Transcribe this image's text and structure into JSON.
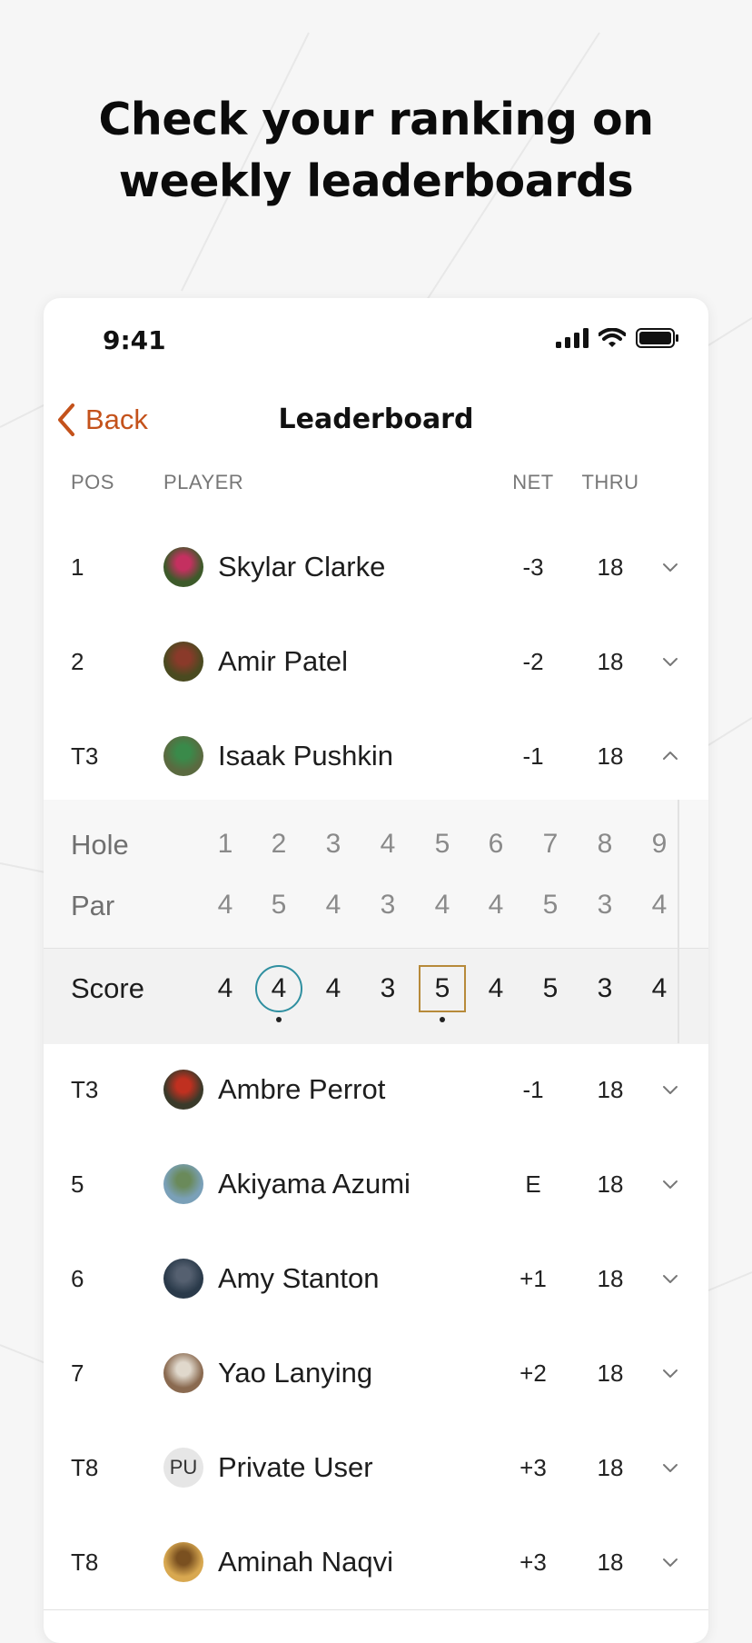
{
  "headline": {
    "line1": "Check your ranking on",
    "line2": "weekly leaderboards"
  },
  "status_bar": {
    "time": "9:41",
    "icons": [
      "cellular-signal-icon",
      "wifi-icon",
      "battery-icon"
    ]
  },
  "nav": {
    "back_label": "Back",
    "title": "Leaderboard"
  },
  "columns": {
    "pos": "POS",
    "player": "PLAYER",
    "net": "NET",
    "thru": "THRU"
  },
  "colors": {
    "accent": "#c4521b",
    "circle_mark": "#2f8fa0",
    "square_mark": "#b78a3a"
  },
  "rows": [
    {
      "pos": "1",
      "name": "Skylar Clarke",
      "net": "-3",
      "thru": "18",
      "avatar": "photo",
      "expanded": false
    },
    {
      "pos": "2",
      "name": "Amir Patel",
      "net": "-2",
      "thru": "18",
      "avatar": "photo",
      "expanded": false
    },
    {
      "pos": "T3",
      "name": "Isaak Pushkin",
      "net": "-1",
      "thru": "18",
      "avatar": "photo",
      "expanded": true
    },
    {
      "pos": "T3",
      "name": "Ambre Perrot",
      "net": "-1",
      "thru": "18",
      "avatar": "photo",
      "expanded": false
    },
    {
      "pos": "5",
      "name": "Akiyama Azumi",
      "net": "E",
      "thru": "18",
      "avatar": "photo",
      "expanded": false
    },
    {
      "pos": "6",
      "name": "Amy Stanton",
      "net": "+1",
      "thru": "18",
      "avatar": "photo",
      "expanded": false
    },
    {
      "pos": "7",
      "name": "Yao Lanying",
      "net": "+2",
      "thru": "18",
      "avatar": "photo",
      "expanded": false
    },
    {
      "pos": "T8",
      "name": "Private User",
      "net": "+3",
      "thru": "18",
      "avatar": "PU",
      "expanded": false
    },
    {
      "pos": "T8",
      "name": "Aminah Naqvi",
      "net": "+3",
      "thru": "18",
      "avatar": "photo",
      "expanded": false
    }
  ],
  "scorecard": {
    "hole_label": "Hole",
    "par_label": "Par",
    "score_label": "Score",
    "holes": [
      "1",
      "2",
      "3",
      "4",
      "5",
      "6",
      "7",
      "8",
      "9"
    ],
    "par": [
      "4",
      "5",
      "4",
      "3",
      "4",
      "4",
      "5",
      "3",
      "4"
    ],
    "score": [
      "4",
      "4",
      "4",
      "3",
      "5",
      "4",
      "5",
      "3",
      "4"
    ],
    "marks": [
      "none",
      "circle",
      "none",
      "none",
      "square",
      "none",
      "none",
      "none",
      "none"
    ],
    "dots": [
      false,
      true,
      false,
      false,
      true,
      false,
      false,
      false,
      false
    ]
  }
}
